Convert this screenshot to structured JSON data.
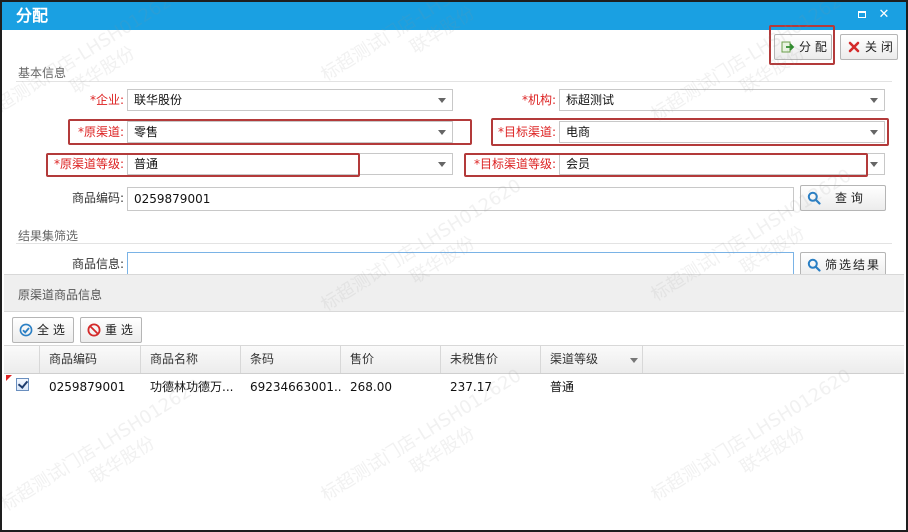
{
  "window": {
    "title": "分配",
    "maximize_icon": "maximize-icon",
    "close_icon": "close-icon"
  },
  "toolbar": {
    "assign_label": "分 配",
    "close_label": "关 闭"
  },
  "basic_info": {
    "section_title": "基本信息",
    "company": {
      "label": "*企业:",
      "value": "联华股份"
    },
    "org": {
      "label": "*机构:",
      "value": "标超测试"
    },
    "source_channel": {
      "label": "*原渠道:",
      "value": "零售"
    },
    "target_channel": {
      "label": "*目标渠道:",
      "value": "电商"
    },
    "source_level": {
      "label": "*原渠道等级:",
      "value": "普通"
    },
    "target_level": {
      "label": "*目标渠道等级:",
      "value": "会员"
    },
    "product_code": {
      "label": "商品编码:",
      "value": "0259879001"
    },
    "query_label": "查 询"
  },
  "filter": {
    "section_title": "结果集筛选",
    "product_info": {
      "label": "商品信息:",
      "value": ""
    },
    "filter_label": "筛选结果"
  },
  "grid_panel": {
    "title": "原渠道商品信息",
    "select_all_label": "全 选",
    "reset_label": "重 选",
    "columns": [
      "商品编码",
      "商品名称",
      "条码",
      "售价",
      "未税售价",
      "渠道等级"
    ],
    "rows": [
      {
        "checked": true,
        "code": "0259879001",
        "name": "功德林功德万...",
        "barcode": "69234663001...",
        "price": "268.00",
        "price_no_tax": "237.17",
        "level": "普通"
      }
    ]
  },
  "watermark": {
    "line1": "标超测试门店-LHSH012620",
    "line2": "联华股份"
  },
  "colors": {
    "titlebar": "#1aa0e2",
    "required_label": "#dd2222",
    "highlight_border": "#b33a3a"
  }
}
